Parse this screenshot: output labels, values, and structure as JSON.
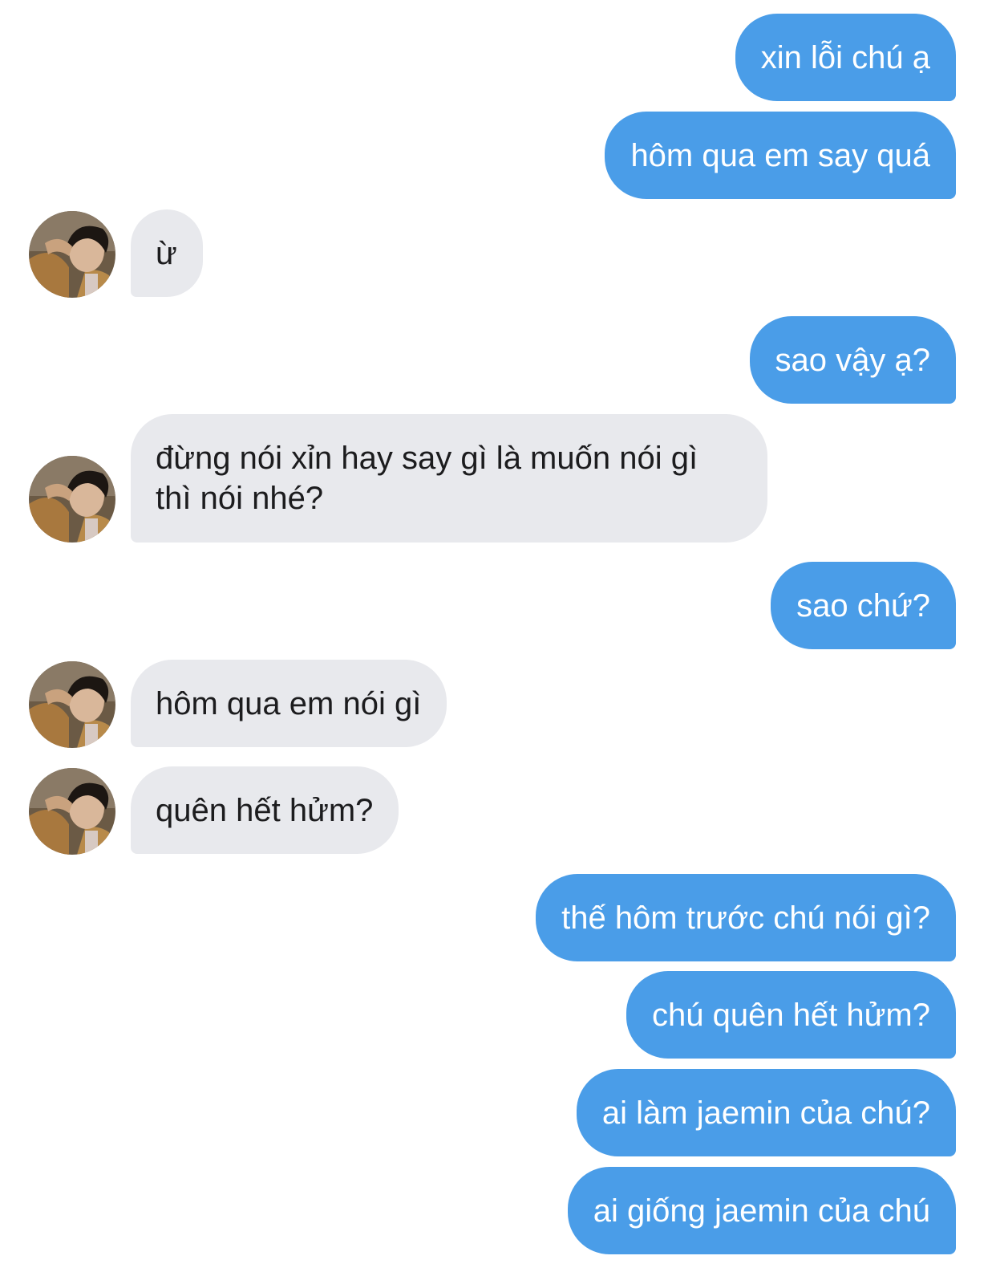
{
  "conversation": {
    "messages": [
      {
        "sender": "me",
        "text": "xin lỗi chú ạ"
      },
      {
        "sender": "me",
        "text": "hôm qua em say quá"
      },
      {
        "sender": "contact",
        "text": "ừ"
      },
      {
        "sender": "me",
        "text": "sao vậy ạ?"
      },
      {
        "sender": "contact",
        "text": "đừng nói xỉn hay say gì là muốn nói gì thì nói nhé?"
      },
      {
        "sender": "me",
        "text": "sao chứ?"
      },
      {
        "sender": "contact",
        "text": "hôm qua em nói gì"
      },
      {
        "sender": "contact",
        "text": "quên hết hửm?"
      },
      {
        "sender": "me",
        "text": "thế hôm trước chú nói gì?"
      },
      {
        "sender": "me",
        "text": "chú quên hết hửm?"
      },
      {
        "sender": "me",
        "text": "ai làm jaemin của chú?"
      },
      {
        "sender": "me",
        "text": "ai giống jaemin của chú"
      }
    ]
  },
  "colors": {
    "outgoing_bubble": "#4a9de8",
    "incoming_bubble": "#e8e9ed",
    "background": "#ffffff"
  }
}
